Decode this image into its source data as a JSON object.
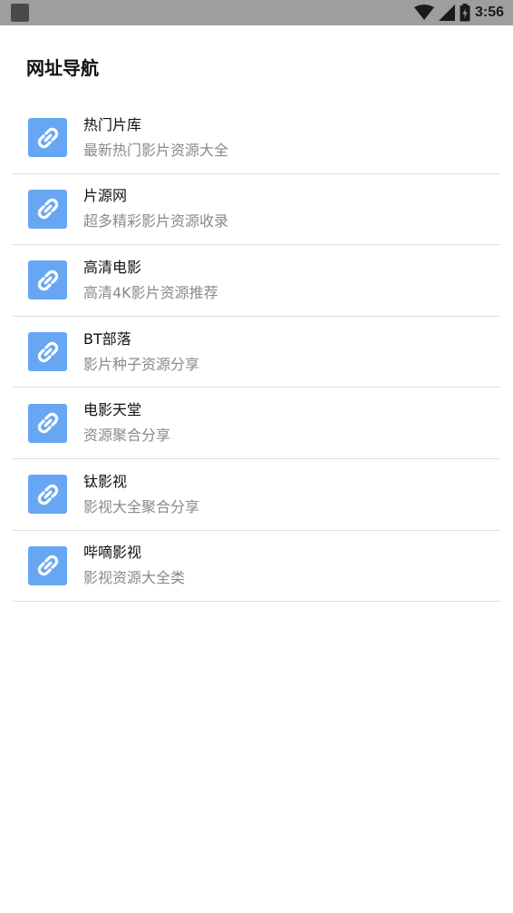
{
  "status_bar": {
    "time": "3:56",
    "icons": [
      "notification-square-icon",
      "wifi-icon",
      "signal-icon",
      "battery-icon"
    ]
  },
  "header": {
    "title": "网址导航"
  },
  "items": [
    {
      "title": "热门片库",
      "desc": "最新热门影片资源大全",
      "icon": "link-icon"
    },
    {
      "title": "片源网",
      "desc": "超多精彩影片资源收录",
      "icon": "link-icon"
    },
    {
      "title": "高清电影",
      "desc": "高清4K影片资源推荐",
      "icon": "link-icon"
    },
    {
      "title": "BT部落",
      "desc": "影片种子资源分享",
      "icon": "link-icon"
    },
    {
      "title": "电影天堂",
      "desc": "资源聚合分享",
      "icon": "link-icon"
    },
    {
      "title": "钛影视",
      "desc": "影视大全聚合分享",
      "icon": "link-icon"
    },
    {
      "title": "哔嘀影视",
      "desc": "影视资源大全类",
      "icon": "link-icon"
    }
  ],
  "colors": {
    "icon_bg": "#67a6f2",
    "status_bar_bg": "#9e9e9e",
    "divider": "#dedede",
    "subtitle": "#8a8a8a"
  }
}
